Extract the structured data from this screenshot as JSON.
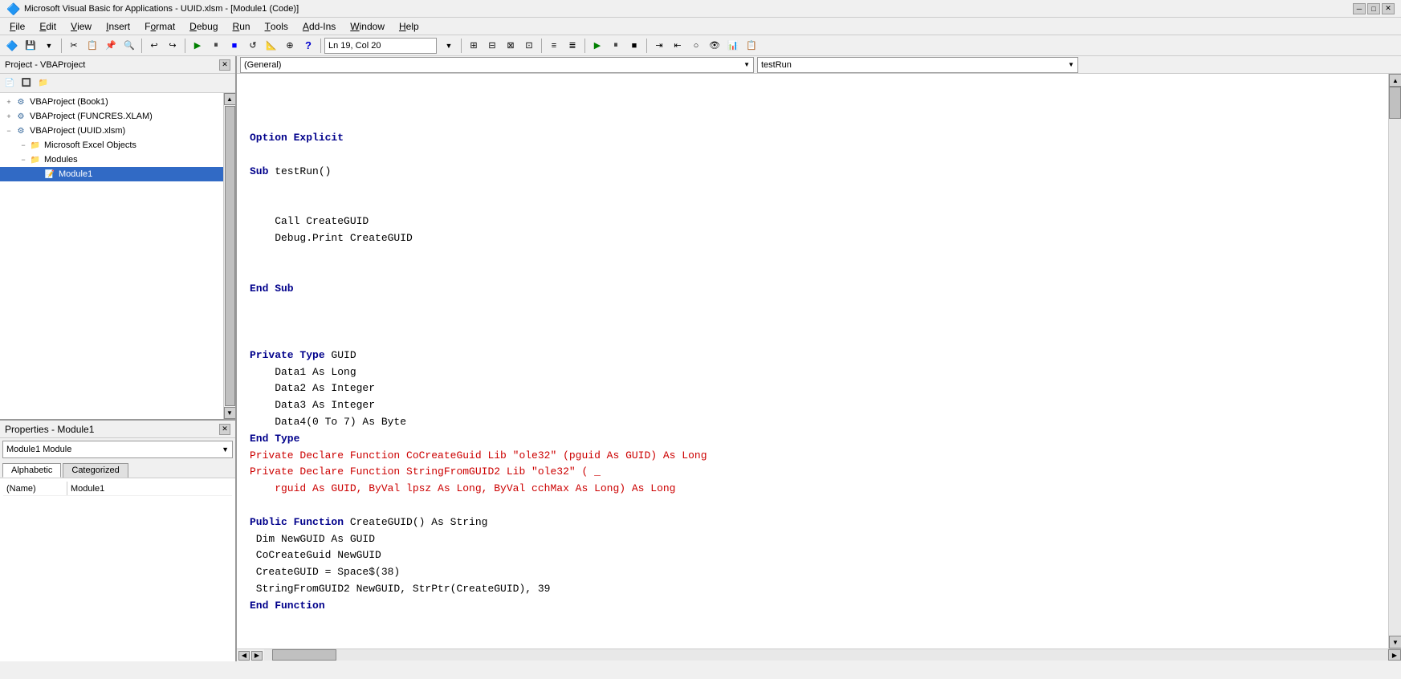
{
  "titlebar": {
    "text": "Microsoft Visual Basic for Applications - UUID.xlsm - [Module1 (Code)]",
    "icon": "vba-icon"
  },
  "menubar": {
    "items": [
      {
        "label": "File",
        "key": "F",
        "id": "menu-file"
      },
      {
        "label": "Edit",
        "key": "E",
        "id": "menu-edit"
      },
      {
        "label": "View",
        "key": "V",
        "id": "menu-view"
      },
      {
        "label": "Insert",
        "key": "I",
        "id": "menu-insert"
      },
      {
        "label": "Format",
        "key": "o",
        "id": "menu-format"
      },
      {
        "label": "Debug",
        "key": "D",
        "id": "menu-debug"
      },
      {
        "label": "Run",
        "key": "R",
        "id": "menu-run"
      },
      {
        "label": "Tools",
        "key": "T",
        "id": "menu-tools"
      },
      {
        "label": "Add-Ins",
        "key": "A",
        "id": "menu-addins"
      },
      {
        "label": "Window",
        "key": "W",
        "id": "menu-window"
      },
      {
        "label": "Help",
        "key": "H",
        "id": "menu-help"
      }
    ]
  },
  "toolbar": {
    "location": "Ln 19, Col 20"
  },
  "project_panel": {
    "title": "Project - VBAProject",
    "tree": [
      {
        "id": "vbaproject-book1",
        "label": "VBAProject (Book1)",
        "indent": 0,
        "type": "vba-project",
        "expanded": false
      },
      {
        "id": "vbaproject-funcres",
        "label": "VBAProject (FUNCRES.XLAM)",
        "indent": 0,
        "type": "vba-project",
        "expanded": false
      },
      {
        "id": "vbaproject-uuid",
        "label": "VBAProject (UUID.xlsm)",
        "indent": 0,
        "type": "vba-project",
        "expanded": true
      },
      {
        "id": "ms-excel-objects",
        "label": "Microsoft Excel Objects",
        "indent": 1,
        "type": "folder",
        "expanded": false
      },
      {
        "id": "modules",
        "label": "Modules",
        "indent": 1,
        "type": "folder",
        "expanded": true
      },
      {
        "id": "module1",
        "label": "Module1",
        "indent": 2,
        "type": "module",
        "expanded": false,
        "selected": true
      }
    ]
  },
  "properties_panel": {
    "title": "Properties - Module1",
    "dropdown": "Module1  Module",
    "tabs": [
      {
        "label": "Alphabetic",
        "active": true
      },
      {
        "label": "Categorized",
        "active": false
      }
    ],
    "rows": [
      {
        "key": "(Name)",
        "value": "Module1"
      }
    ]
  },
  "code_header": {
    "left_dropdown": "(General)",
    "right_dropdown": "testRun"
  },
  "code": {
    "lines": [
      {
        "text": "",
        "style": "normal"
      },
      {
        "text": "",
        "style": "normal"
      },
      {
        "text": "",
        "style": "normal"
      },
      {
        "text": "Option Explicit",
        "style": "keyword"
      },
      {
        "text": "",
        "style": "normal"
      },
      {
        "text": "Sub testRun()",
        "style": "mixed_sub"
      },
      {
        "text": "",
        "style": "normal"
      },
      {
        "text": "",
        "style": "normal"
      },
      {
        "text": "    Call CreateGUID",
        "style": "normal"
      },
      {
        "text": "    Debug.Print CreateGUID",
        "style": "normal"
      },
      {
        "text": "",
        "style": "normal"
      },
      {
        "text": "",
        "style": "normal"
      },
      {
        "text": "End Sub",
        "style": "keyword"
      },
      {
        "text": "",
        "style": "normal"
      },
      {
        "text": "",
        "style": "normal"
      },
      {
        "text": "",
        "style": "normal"
      },
      {
        "text": "Private Type GUID",
        "style": "mixed_private_type"
      },
      {
        "text": "    Data1 As Long",
        "style": "indent_normal"
      },
      {
        "text": "    Data2 As Integer",
        "style": "indent_normal"
      },
      {
        "text": "    Data3 As Integer",
        "style": "indent_normal"
      },
      {
        "text": "    Data4(0 To 7) As Byte",
        "style": "indent_normal"
      },
      {
        "text": "End Type",
        "style": "keyword"
      },
      {
        "text": "Private Declare Function CoCreateGuid Lib \"ole32\" (pguid As GUID) As Long",
        "style": "declare"
      },
      {
        "text": "Private Declare Function StringFromGUID2 Lib \"ole32\" ( _",
        "style": "declare"
      },
      {
        "text": "    rguid As GUID, ByVal lpsz As Long, ByVal cchMax As Long) As Long",
        "style": "declare"
      },
      {
        "text": "",
        "style": "normal"
      },
      {
        "text": "Public Function CreateGUID() As String",
        "style": "mixed_public"
      },
      {
        "text": " Dim NewGUID As GUID",
        "style": "normal"
      },
      {
        "text": " CoCreateGuid NewGUID",
        "style": "normal"
      },
      {
        "text": " CreateGUID = Space$(38)",
        "style": "normal"
      },
      {
        "text": " StringFromGUID2 NewGUID, StrPtr(CreateGUID), 39",
        "style": "normal"
      },
      {
        "text": "End Function",
        "style": "keyword"
      }
    ]
  },
  "status_bar": {
    "text": ""
  }
}
